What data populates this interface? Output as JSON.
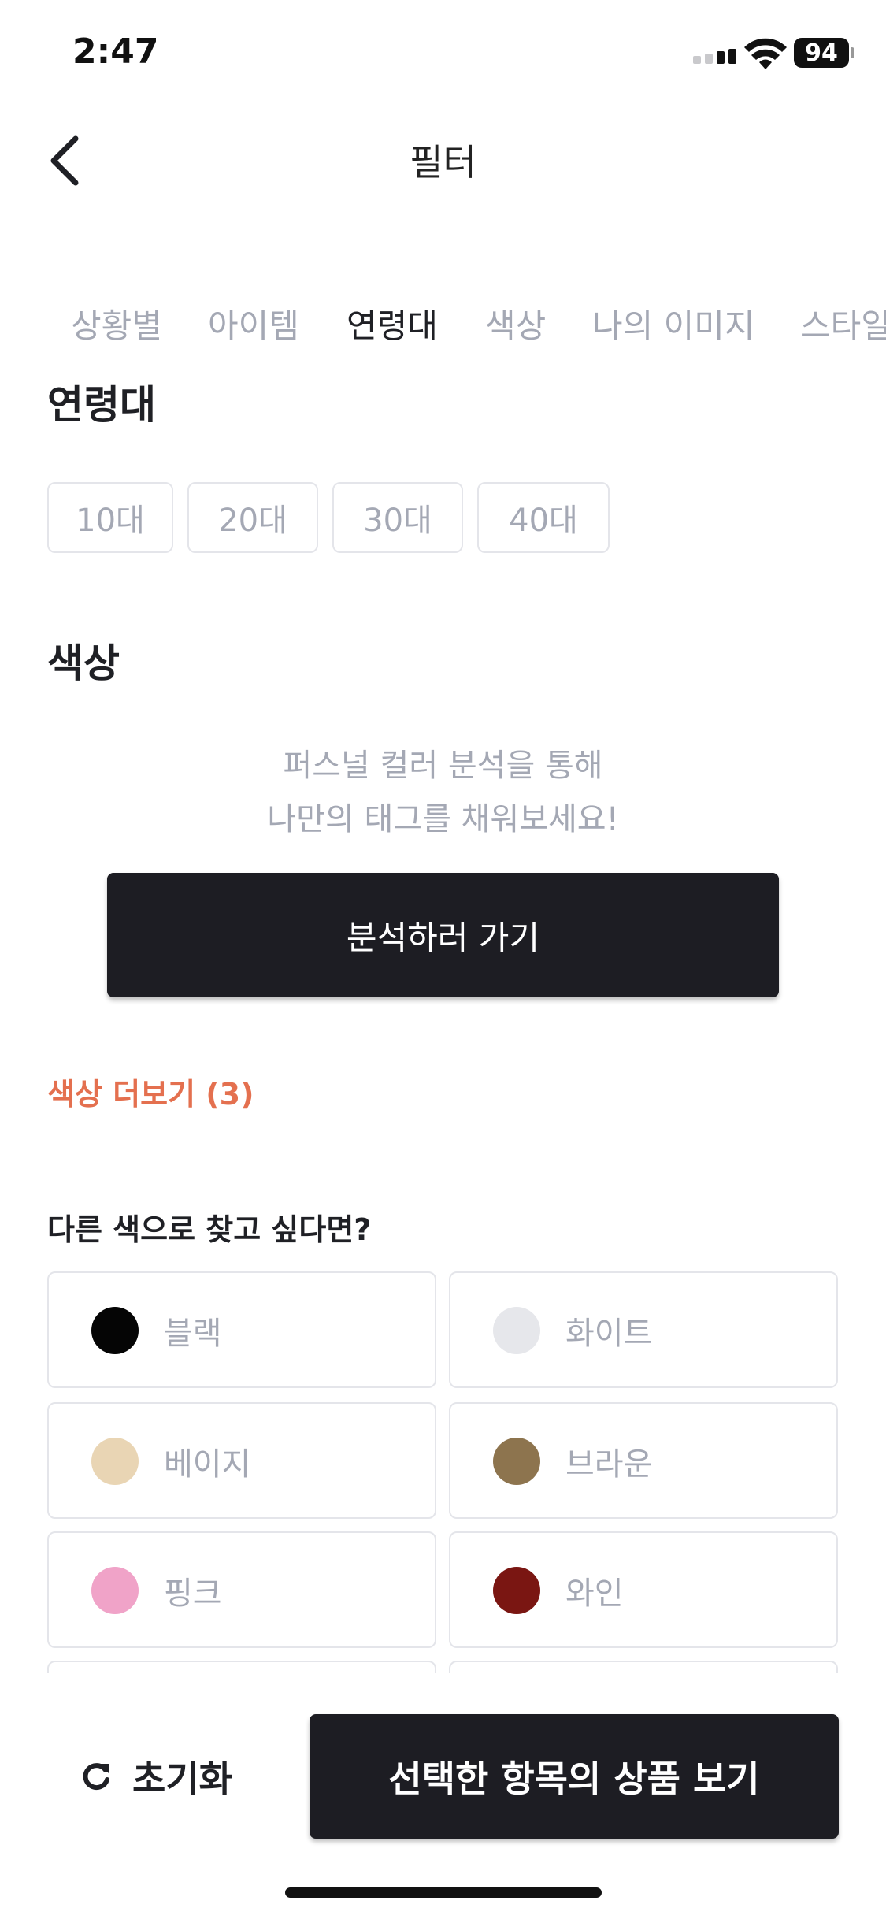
{
  "status_bar": {
    "time": "2:47",
    "battery": "94"
  },
  "header": {
    "title": "필터",
    "back_icon": "chevron-left-icon"
  },
  "tabs": [
    {
      "label": "상황별",
      "active": false
    },
    {
      "label": "아이템",
      "active": false
    },
    {
      "label": "연령대",
      "active": true
    },
    {
      "label": "색상",
      "active": false
    },
    {
      "label": "나의 이미지",
      "active": false
    },
    {
      "label": "스타일",
      "active": false
    }
  ],
  "age_section": {
    "title": "연령대",
    "options": [
      "10대",
      "20대",
      "30대",
      "40대"
    ]
  },
  "color_section": {
    "title": "색상",
    "helper_line1": "퍼스널 컬러 분석을 통해",
    "helper_line2": "나만의 태그를 채워보세요!",
    "analyze_button": "분석하러 가기",
    "more_colors": "색상 더보기 (3)",
    "other_colors_title": "다른 색으로 찾고 싶다면?",
    "colors": [
      {
        "label": "블랙",
        "swatch": "#050505"
      },
      {
        "label": "화이트",
        "swatch": "#e6e7eb"
      },
      {
        "label": "베이지",
        "swatch": "#e9d5b4"
      },
      {
        "label": "브라운",
        "swatch": "#8d744e"
      },
      {
        "label": "핑크",
        "swatch": "#f0a3c8"
      },
      {
        "label": "와인",
        "swatch": "#7a1612"
      }
    ]
  },
  "footer": {
    "reset_label": "초기화",
    "reset_icon": "refresh-icon",
    "apply_button": "선택한 항목의 상품 보기"
  },
  "theme": {
    "accent": "#e4704f",
    "dark": "#1d1d23",
    "muted_text": "#a4a8b4",
    "border": "#e4e5ea"
  }
}
